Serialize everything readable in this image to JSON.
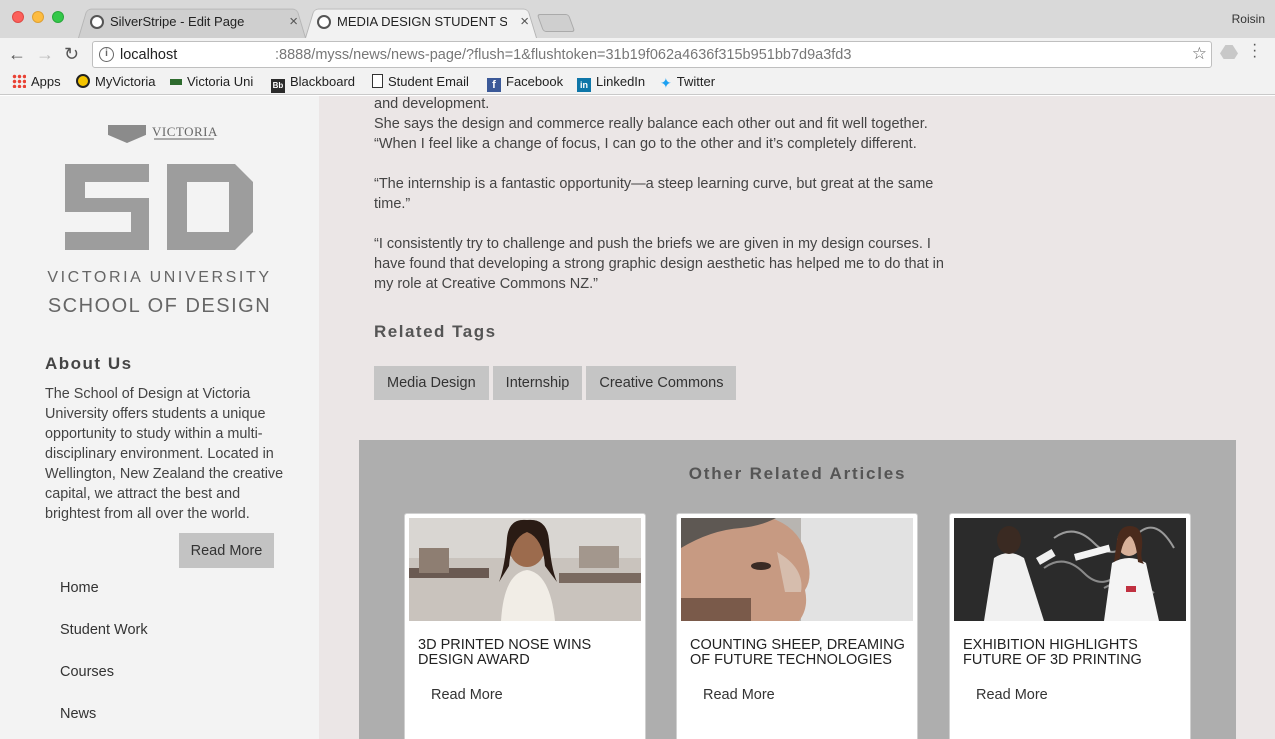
{
  "browser": {
    "tabs": [
      {
        "label": "SilverStripe - Edit Page",
        "close": "×"
      },
      {
        "label": "MEDIA DESIGN STUDENT SECURES",
        "close": "×"
      }
    ],
    "profile": "Roisin",
    "url_host": "localhost",
    "url_path": ":8888/myss/news/news-page/?flush=1&flushtoken=31b19f062a4636f315b951bb7d9a3fd3",
    "bookmarks": [
      "Apps",
      "MyVictoria",
      "Victoria Uni",
      "Blackboard",
      "Student Email",
      "Facebook",
      "LinkedIn",
      "Twitter"
    ]
  },
  "sidebar": {
    "crest_word": "VICTORIA",
    "logo_text": "5D",
    "university": "VICTORIA UNIVERSITY",
    "school": "SCHOOL OF DESIGN",
    "about_heading": "About Us",
    "about_text": "The School of Design at Victoria University offers students a unique opportunity to study within a multi-disciplinary environment. Located in Wellington, New Zealand the creative capital, we attract the best and brightest from all over the world.",
    "read_more": "Read More",
    "nav": [
      "Home",
      "Student Work",
      "Courses",
      "News"
    ]
  },
  "article": {
    "p1_line1": "and development.",
    "p1_line2": "She says the design and commerce really balance each other out and fit well together.",
    "p1_line3": "“When I feel like a change of focus, I can go to the other and it’s completely different.",
    "p2": "“The internship is a fantastic opportunity—a steep learning curve, but great at the same time.”",
    "p3": "“I consistently try to challenge and push the briefs we are given in my design courses. I have found that developing a strong graphic design aesthetic has helped me to do that in my role at Creative Commons NZ.”"
  },
  "tags": {
    "heading": "Related Tags",
    "items": [
      "Media Design",
      "Internship",
      "Creative Commons"
    ]
  },
  "related": {
    "heading": "Other Related Articles",
    "cards": [
      {
        "title": "3D PRINTED NOSE WINS DESIGN AWARD",
        "more": "Read More"
      },
      {
        "title": "COUNTING SHEEP, DREAMING OF FUTURE TECHNOLOGIES",
        "more": "Read More"
      },
      {
        "title": "EXHIBITION HIGHLIGHTS FUTURE OF 3D PRINTING",
        "more": "Read More"
      }
    ]
  },
  "colors": {
    "sidebar_bg": "#f3f3f3",
    "content_bg": "#ebe6e6",
    "panel_bg": "#aeaeae",
    "tag_bg": "#c5c5c5"
  }
}
